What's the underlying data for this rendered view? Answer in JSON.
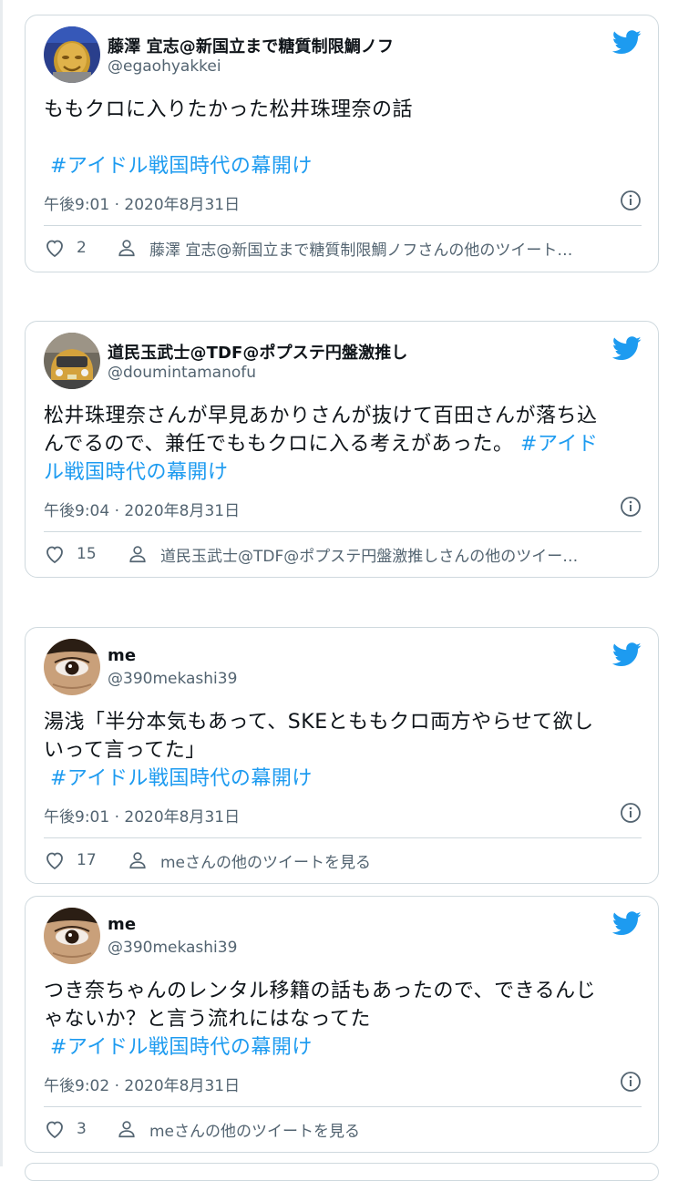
{
  "tweets": [
    {
      "author_name": "藤澤 宜志@新国立まで糖質制限鯛ノフ",
      "author_handle": "@egaohyakkei",
      "text": "ももクロに入りたかった松井珠理奈の話",
      "hashtag": "#アイドル戦国時代の幕開け",
      "timestamp": "午後9:01 · 2020年8月31日",
      "likes": "2",
      "more_tweets": "藤澤 宜志@新国立まで糖質制限鯛ノフさんの他のツイート…"
    },
    {
      "author_name": "道民玉武士@TDF@ポプステ円盤激推し",
      "author_handle": "@doumintamanofu",
      "text_line1": "松井珠理奈さんが早見あかりさんが抜けて百田さんが落ち込",
      "text_line2": "んでるので、兼任でももクロに入る考えがあった。",
      "hashtag_part1": "#アイド",
      "hashtag_part2": "ル戦国時代の幕開け",
      "timestamp": "午後9:04 · 2020年8月31日",
      "likes": "15",
      "more_tweets": "道民玉武士@TDF@ポプステ円盤激推しさんの他のツイー…"
    },
    {
      "author_name": "me",
      "author_handle": "@390mekashi39",
      "text_line1": "湯浅「半分本気もあって、SKEとももクロ両方やらせて欲し",
      "text_line2": "いって言ってた」",
      "hashtag": "#アイドル戦国時代の幕開け",
      "timestamp": "午後9:01 · 2020年8月31日",
      "likes": "17",
      "more_tweets": "meさんの他のツイートを見る"
    },
    {
      "author_name": "me",
      "author_handle": "@390mekashi39",
      "text_line1": "つき奈ちゃんのレンタル移籍の話もあったので、できるんじ",
      "text_line2": "ゃないか？と言う流れにはなってた",
      "hashtag": "#アイドル戦国時代の幕開け",
      "timestamp": "午後9:02 · 2020年8月31日",
      "likes": "3",
      "more_tweets": "meさんの他のツイートを見る"
    }
  ],
  "colors": {
    "hashtag": "#1d9bf0",
    "twitter_bird": "#1d9bf0",
    "secondary_text": "#536471",
    "border": "#cfd9de"
  },
  "icons": [
    "twitter-bird-icon",
    "info-icon",
    "heart-icon",
    "person-icon"
  ]
}
